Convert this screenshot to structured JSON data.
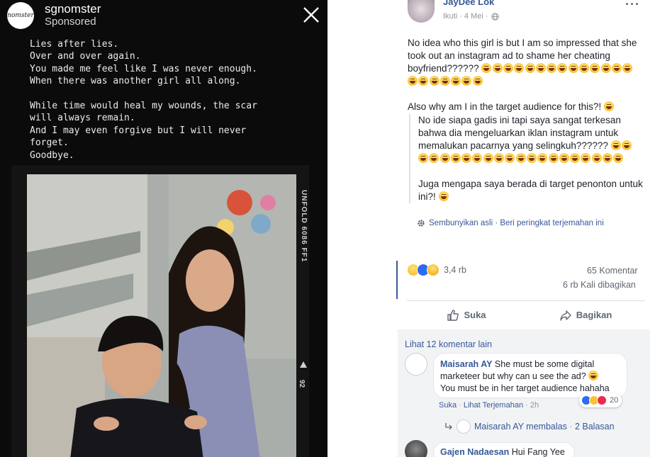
{
  "story": {
    "username": "sgnomster",
    "sponsored": "Sponsored",
    "avatar_logo": "nomster",
    "poem": "Lies after lies.\nOver and over again.\nYou made me feel like I was never enough.\nWhen there was another girl all along.\n\nWhile time would heal my wounds, the scar\nwill always remain.\nAnd I may even forgive but I will never\nforget.\nGoodbye.",
    "film_text": "UNFOLD 6086 FF1",
    "film_number": "92",
    "icons": {
      "close": "close-icon"
    }
  },
  "post": {
    "author": "JayDee Lok",
    "follow": "Ikuti",
    "date": "4 Mei",
    "text_1": "No idea who this girl is but I am so impressed that she took out an instagram ad to shame her cheating boyfriend??????",
    "text_2": "Also why am I in the target audience for this?!",
    "translation_1": "No ide siapa gadis ini tapi saya sangat terkesan bahwa dia mengeluarkan iklan instagram untuk memalukan pacarnya yang selingkuh??????",
    "translation_2": "Juga mengapa saya berada di target penonton untuk ini?!",
    "hide_original": "Sembunyikan asli",
    "rate_translation": "Beri peringkat terjemahan ini",
    "reaction_count": "3,4 rb",
    "comments_count": "65 Komentar",
    "shares_count": "6 rb Kali dibagikan",
    "like_label": "Suka",
    "share_label": "Bagikan",
    "icons": {
      "more": "more-icon",
      "globe": "globe-icon",
      "gear": "gear-icon",
      "like": "like-icon",
      "share": "share-icon"
    }
  },
  "comments": {
    "more_comments": "Lihat 12 komentar lain",
    "c1": {
      "name": "Maisarah AY",
      "text": "She must be some digital marketeer but why can u see the ad?",
      "text_2": "You must be in her target audience hahaha",
      "like": "Suka",
      "see_translation": "Lihat Terjemahan",
      "time": "2h",
      "reaction_count": "20"
    },
    "reply_summary_name": "Maisarah AY membalas",
    "reply_summary_count": "2 Balasan",
    "c2": {
      "name": "Gajen Nadaesan",
      "text": "Hui Fang Yee"
    }
  },
  "colors": {
    "link": "#385898",
    "fb_blue": "#3b5998",
    "comment_bg": "#f2f3f5",
    "story_bg": "#0b0b0b"
  }
}
